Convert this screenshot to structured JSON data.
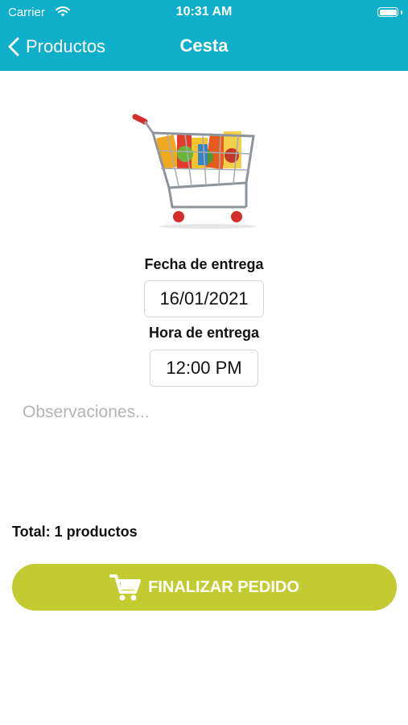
{
  "status_bar": {
    "carrier": "Carrier",
    "time": "10:31 AM",
    "icons": [
      "wifi-icon",
      "battery-icon"
    ]
  },
  "nav": {
    "back_label": "Productos",
    "title": "Cesta",
    "back_icon": "chevron-left-icon"
  },
  "colors": {
    "header": "#0faecb",
    "button": "#c2cb2f",
    "placeholder": "#b3b3b3"
  },
  "form": {
    "date_label": "Fecha de entrega",
    "date_value": "16/01/2021",
    "time_label": "Hora de entrega",
    "time_value": "12:00 PM",
    "notes_placeholder": "Observaciones..."
  },
  "summary": {
    "total_text": "Total: 1 productos"
  },
  "actions": {
    "finalize_label": "FINALIZAR PEDIDO",
    "finalize_icon": "cart-icon"
  }
}
